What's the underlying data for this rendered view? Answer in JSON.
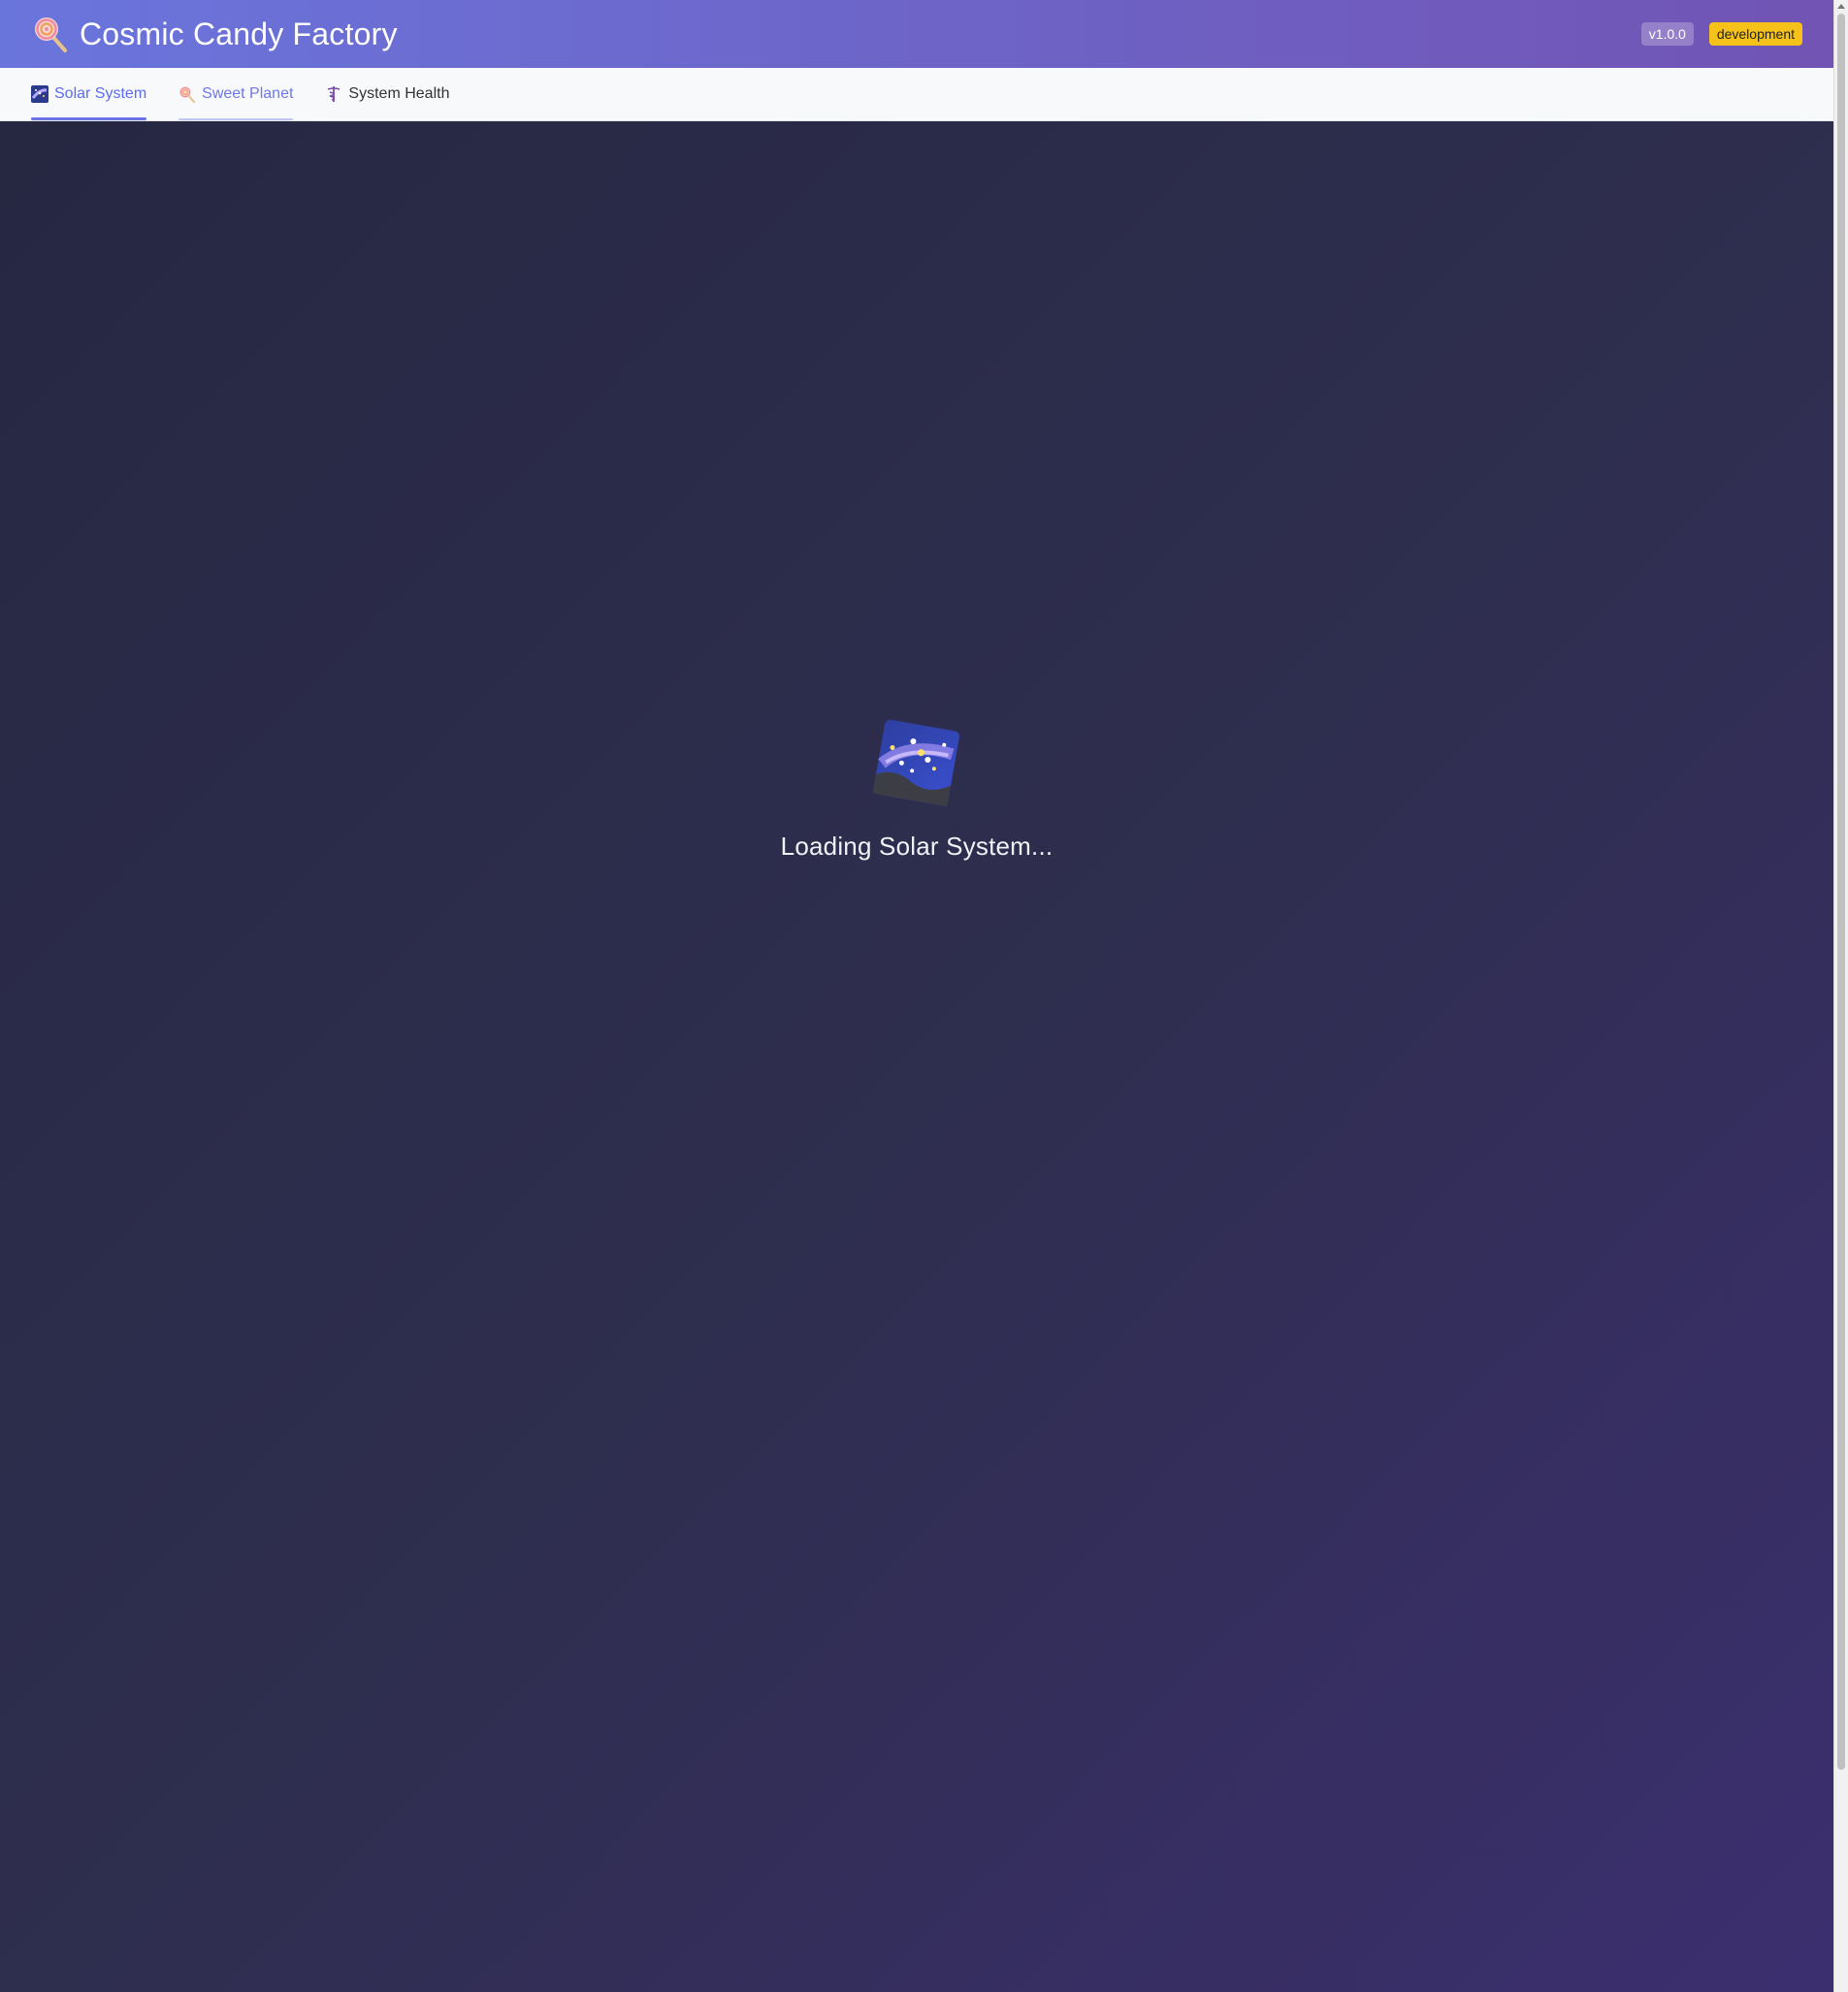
{
  "header": {
    "title": "Cosmic Candy Factory",
    "logo_icon": "lollipop-icon",
    "version": "v1.0.0",
    "environment": "development"
  },
  "tabs": [
    {
      "label": "Solar System",
      "icon": "milky-way-icon",
      "state": "active"
    },
    {
      "label": "Sweet Planet",
      "icon": "lollipop-icon",
      "state": "hover"
    },
    {
      "label": "System Health",
      "icon": "caduceus-icon",
      "state": "default"
    }
  ],
  "main": {
    "loading_text": "Loading Solar System...",
    "loading_icon": "milky-way-icon"
  },
  "colors": {
    "header_start": "#6a75dc",
    "header_end": "#7154b4",
    "accent": "#5b6cf2",
    "env_badge": "#f6c21a",
    "background_start": "#262842",
    "background_end": "#3c2f70"
  }
}
